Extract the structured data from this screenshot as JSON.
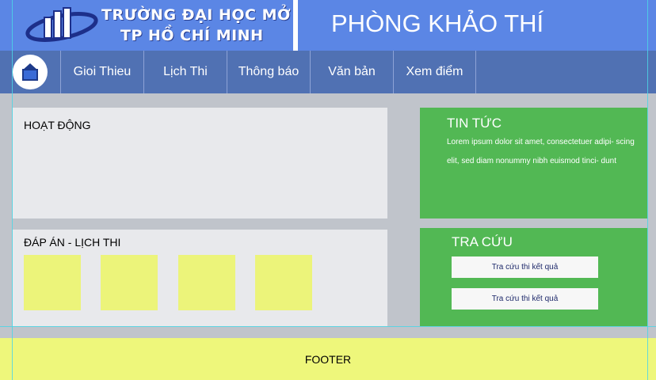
{
  "header": {
    "university_line1": "TRƯỜNG ĐẠI HỌC MỞ",
    "university_line2": "TP HỒ CHÍ MINH",
    "department_title": "PHÒNG KHẢO THÍ"
  },
  "nav": {
    "home_icon": "home-icon",
    "items": [
      {
        "label": "Gioi Thieu"
      },
      {
        "label": "Lịch Thi"
      },
      {
        "label": "Thông báo"
      },
      {
        "label": "Văn bản"
      },
      {
        "label": "Xem điểm"
      }
    ]
  },
  "activities": {
    "title": "HOẠT ĐỘNG"
  },
  "answers": {
    "title": "ĐÁP ÁN -  LỊCH THI",
    "boxes": 4
  },
  "news": {
    "title": "TIN TỨC",
    "body": "Lorem ipsum dolor sit amet, consectetuer adipi- scing elit, sed diam nonummy nibh euismod tinci- dunt"
  },
  "lookup": {
    "title": "TRA CỨU",
    "buttons": [
      {
        "label": "Tra cứu thi kết quả"
      },
      {
        "label": "Tra cứu thi kết quả"
      }
    ]
  },
  "footer": {
    "label": "FOOTER"
  },
  "colors": {
    "header_blue": "#5b86e5",
    "nav_blue": "#5071b3",
    "panel_green": "#52b854",
    "footer_yellow": "#eef77b",
    "box_yellow": "#ecf47a",
    "background_gray": "#c0c4cb"
  }
}
